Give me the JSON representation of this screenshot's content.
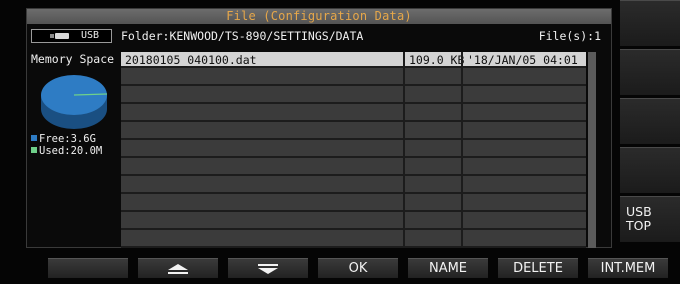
{
  "window": {
    "title": "File (Configuration Data)"
  },
  "media": {
    "label": "USB",
    "icon": "usb-stick-icon"
  },
  "folder": {
    "path": "Folder:KENWOOD/TS-890/SETTINGS/DATA",
    "count": "File(s):1"
  },
  "memory": {
    "title": "Memory Space",
    "free_label": "Free:3.6G",
    "used_label": "Used:20.0M",
    "free_color": "#2e7cc4",
    "used_color": "#6fd08a"
  },
  "files": [
    {
      "name": "20180105_040100.dat",
      "size": "109.0 KB",
      "date": "'18/JAN/05 04:01"
    }
  ],
  "softkeys": [
    "",
    "",
    "",
    "",
    "USB\nTOP"
  ],
  "function_keys": {
    "blank": "",
    "up_icon": "triangle-up-icon",
    "down_icon": "triangle-down-icon",
    "ok": "OK",
    "name": "NAME",
    "delete": "DELETE",
    "intmem": "INT.MEM"
  }
}
